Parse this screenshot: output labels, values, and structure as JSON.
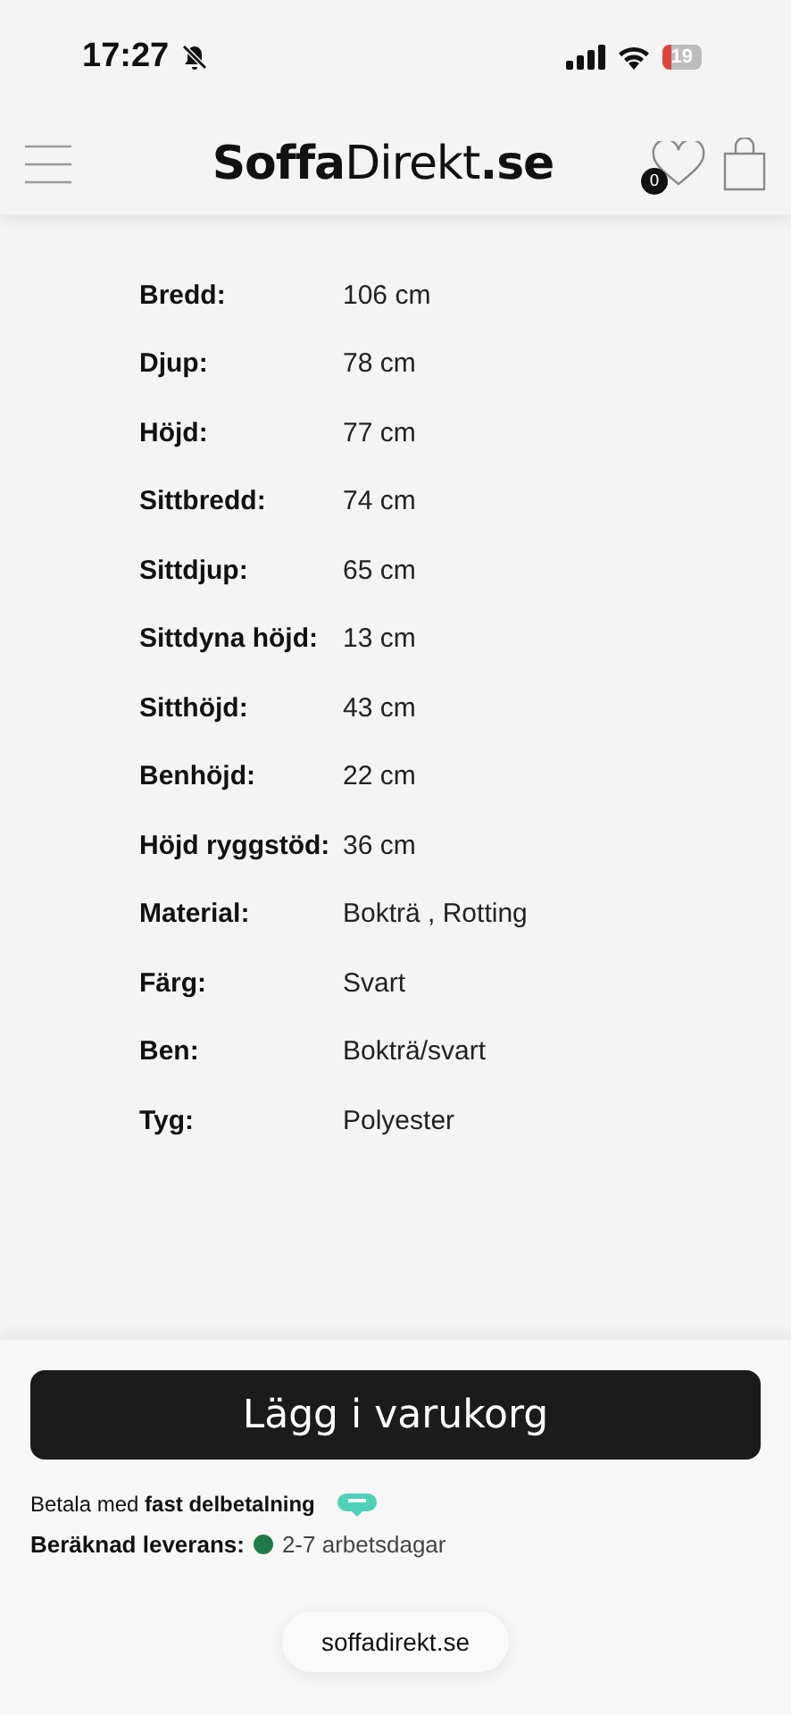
{
  "status_bar": {
    "time": "17:27",
    "battery": "19"
  },
  "header": {
    "logo": "**Soffa**Direkt**.se**",
    "wishlist_count": "0"
  },
  "specs": [
    {
      "label": "Bredd:",
      "value": "106 cm"
    },
    {
      "label": "Djup:",
      "value": "78 cm"
    },
    {
      "label": "Höjd:",
      "value": "77 cm"
    },
    {
      "label": "Sittbredd:",
      "value": "74 cm"
    },
    {
      "label": "Sittdjup:",
      "value": "65 cm"
    },
    {
      "label": "Sittdyna höjd:",
      "value": "13 cm"
    },
    {
      "label": "Sitthöjd:",
      "value": "43 cm"
    },
    {
      "label": "Benhöjd:",
      "value": "22 cm"
    },
    {
      "label": "Höjd ryggstöd:",
      "value": "36 cm"
    },
    {
      "label": "Material:",
      "value": "Bokträ , Rotting"
    },
    {
      "label": "Färg:",
      "value": "Svart"
    },
    {
      "label": "Ben:",
      "value": "Bokträ/svart"
    },
    {
      "label": "Tyg:",
      "value": "Polyester"
    }
  ],
  "cart_button": "Lägg i varukorg",
  "payment": "Betala med **fast delbetalning**",
  "delivery": {
    "label": "Beräknad leverans:",
    "color": "#1f7a4a",
    "value": "2-7 arbetsdagar"
  },
  "url_pill": "soffadirekt.se"
}
